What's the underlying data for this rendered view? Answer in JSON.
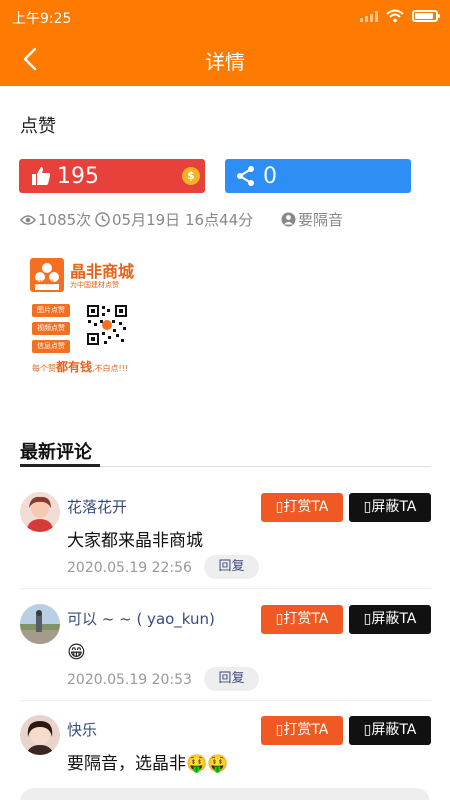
{
  "status_bar": {
    "time": "上午9:25"
  },
  "nav": {
    "title": "详情"
  },
  "section_label": "点赞",
  "like": {
    "count": "195"
  },
  "share": {
    "count": "0"
  },
  "meta": {
    "views": "1085次",
    "date": "05月19日 16点44分",
    "author": "要隔音"
  },
  "ad": {
    "brand": "晶非商城",
    "brand_sub": "为中国建材点赞",
    "logo_caption": "建材点赞",
    "tags": [
      "图片点赞",
      "视频点赞",
      "信息点赞"
    ],
    "slogan_prefix": "每个赞",
    "slogan_highlight": "都有钱",
    "slogan_suffix": ",不白点!!!"
  },
  "comments_title": "最新评论",
  "comments": [
    {
      "name": "花落花开",
      "text": "大家都来晶非商城",
      "date": "2020.05.19 22:56",
      "reply": "回复",
      "reward": "▯打赏TA",
      "block": "▯屏蔽TA"
    },
    {
      "name": "可以 ~ ~ ( yao_kun)",
      "emoji": "😁",
      "date": "2020.05.19 20:53",
      "reply": "回复",
      "reward": "▯打赏TA",
      "block": "▯屏蔽TA"
    },
    {
      "name": "快乐",
      "text": "要隔音，选晶非🤑🤑",
      "reward": "▯打赏TA",
      "block": "▯屏蔽TA"
    }
  ],
  "colors": {
    "primary": "#ff7a00",
    "like": "#e8413b",
    "share": "#2d8ff5",
    "reward": "#f05a22",
    "block": "#111111"
  }
}
